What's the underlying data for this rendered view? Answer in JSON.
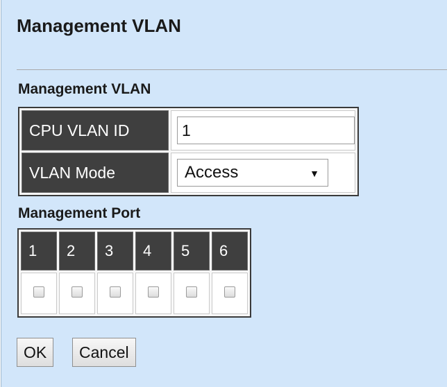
{
  "page": {
    "title": "Management VLAN"
  },
  "management_vlan": {
    "heading": "Management VLAN",
    "cpu_vlan_id_label": "CPU VLAN ID",
    "cpu_vlan_id_value": "1",
    "vlan_mode_label": "VLAN Mode",
    "vlan_mode_value": "Access"
  },
  "management_port": {
    "heading": "Management Port",
    "ports": [
      "1",
      "2",
      "3",
      "4",
      "5",
      "6"
    ],
    "checked": [
      false,
      false,
      false,
      false,
      false,
      false
    ]
  },
  "buttons": {
    "ok": "OK",
    "cancel": "Cancel"
  },
  "colors": {
    "background": "#d2e6fa",
    "header_cell": "#3f3f3f"
  }
}
